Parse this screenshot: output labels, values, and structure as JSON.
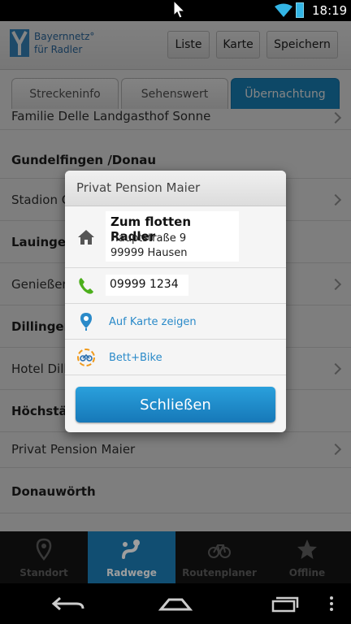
{
  "status_bar": {
    "time": "18:19"
  },
  "app": {
    "logo_line1": "Bayernnetz°",
    "logo_line2": "für Radler"
  },
  "toolbar": {
    "liste_label": "Liste",
    "karte_label": "Karte",
    "speichern_label": "Speichern"
  },
  "tabs": [
    {
      "label": "Streckeninfo",
      "active": false
    },
    {
      "label": "Sehenswert",
      "active": false
    },
    {
      "label": "Übernachtung",
      "active": true
    }
  ],
  "list": {
    "rows": [
      {
        "label": "Familie Delle Landgasthof Sonne",
        "type": "item"
      },
      {
        "label": "Gundelfingen /Donau",
        "type": "header"
      },
      {
        "label": "Stadion C",
        "type": "item"
      },
      {
        "label": "Lauingen",
        "type": "header"
      },
      {
        "label": "Genießer",
        "type": "item"
      },
      {
        "label": "Dillingen",
        "type": "header"
      },
      {
        "label": "Hotel Dill",
        "type": "item"
      },
      {
        "label": "Höchstäd",
        "type": "header"
      },
      {
        "label": "Privat Pension Maier",
        "type": "item"
      },
      {
        "label": "Donauwörth",
        "type": "header"
      }
    ]
  },
  "dialog": {
    "title": "Privat Pension Maier",
    "name": "Zum flotten Radler",
    "street": "Hauptstraße 9",
    "city": "99999 Hausen",
    "phone": "09999 1234",
    "map_link": "Auf Karte zeigen",
    "bettbike_link": "Bett+Bike",
    "close_label": "Schließen"
  },
  "bottom_nav": [
    {
      "label": "Standort",
      "active": false
    },
    {
      "label": "Radwege",
      "active": true
    },
    {
      "label": "Routenplaner",
      "active": false
    },
    {
      "label": "Offline",
      "active": false
    }
  ],
  "colors": {
    "accent": "#1a8ac6",
    "link": "#2a8ac9",
    "phone_icon": "#4caf1c"
  }
}
